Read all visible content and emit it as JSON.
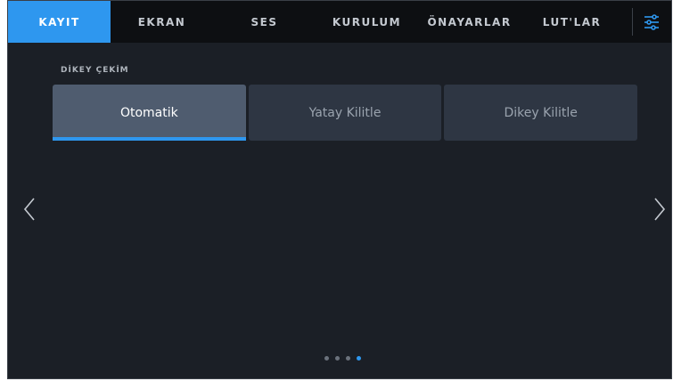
{
  "tabs": [
    {
      "label": "KAYIT",
      "active": true
    },
    {
      "label": "EKRAN",
      "active": false
    },
    {
      "label": "SES",
      "active": false
    },
    {
      "label": "KURULUM",
      "active": false
    },
    {
      "label": "ÖNAYARLAR",
      "active": false
    },
    {
      "label": "LUT'LAR",
      "active": false
    }
  ],
  "menu_icon": "sliders-icon",
  "section": {
    "label": "DİKEY ÇEKİM",
    "options": [
      {
        "label": "Otomatik",
        "selected": true
      },
      {
        "label": "Yatay Kilitle",
        "selected": false
      },
      {
        "label": "Dikey Kilitle",
        "selected": false
      }
    ]
  },
  "navigation": {
    "prev_icon": "chevron-left-icon",
    "next_icon": "chevron-right-icon"
  },
  "pagination": {
    "total": 4,
    "current": 4
  },
  "colors": {
    "accent": "#2e97ef",
    "background": "#1b1f26",
    "tabbar": "#0d0f12",
    "segment": "#2e3643",
    "segment_selected": "#4f5c6f"
  }
}
